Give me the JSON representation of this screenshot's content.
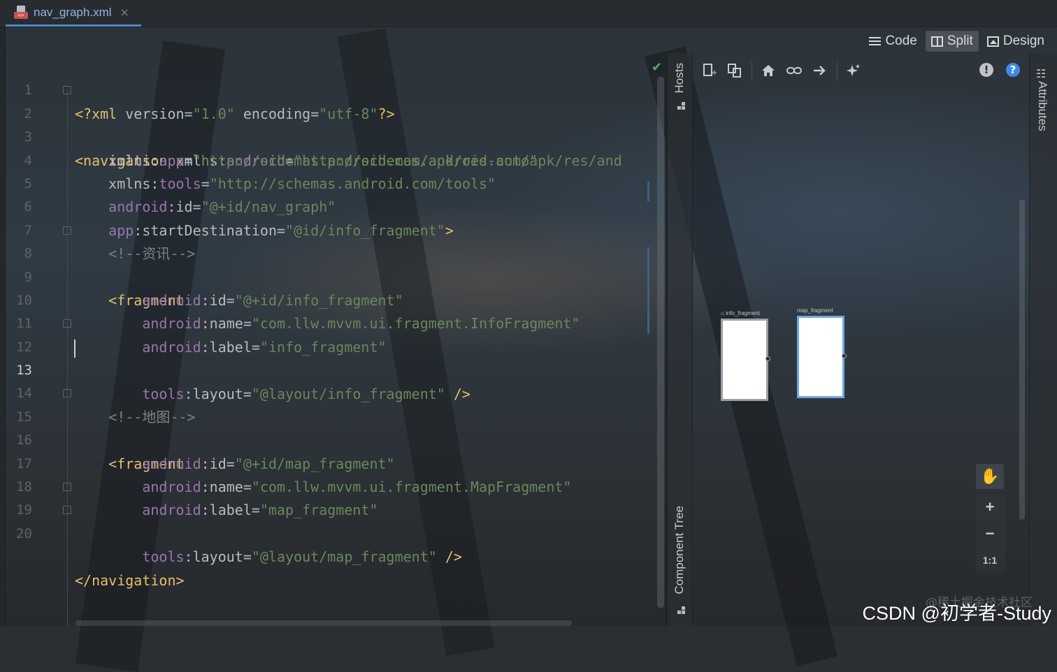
{
  "tab": {
    "filename": "nav_graph.xml",
    "close": "×"
  },
  "view_modes": [
    {
      "label": "Code",
      "icon": "text-lines-icon"
    },
    {
      "label": "Split",
      "icon": "split-view-icon",
      "active": true
    },
    {
      "label": "Design",
      "icon": "image-icon"
    }
  ],
  "editor": {
    "current_line": 13,
    "line_numbers": [
      "1",
      "2",
      "3",
      "4",
      "5",
      "6",
      "7",
      "8",
      "9",
      "10",
      "11",
      "12",
      "13",
      "14",
      "15",
      "16",
      "17",
      "18",
      "19",
      "20"
    ]
  },
  "side_panels": {
    "hosts": "Hosts",
    "component_tree": "Component Tree",
    "attributes": "Attributes"
  },
  "design_toolbar": {
    "icons": [
      "new-destination-icon",
      "nested-graph-icon",
      "home-icon",
      "link-icon",
      "action-arrow-icon",
      "auto-arrange-icon",
      "warning-icon",
      "help-icon"
    ],
    "warning_glyph": "!",
    "help_glyph": "?"
  },
  "canvas": {
    "destinations": [
      {
        "label": "info_fragment",
        "start_destination": true
      },
      {
        "label": "map_fragment",
        "selected": true
      }
    ],
    "zoom": {
      "zoom_in": "+",
      "zoom_out": "−",
      "reset": "1:1"
    }
  },
  "watermarks": {
    "faint": "@稀土掘金技术社区",
    "main": "CSDN @初学者-Study"
  },
  "colors": {
    "tag": "#e8bf6a",
    "namespace": "#9876aa",
    "attribute": "#bababa",
    "value": "#6a8759",
    "comment": "#808080",
    "accent": "#4a88c7",
    "selected_border": "#6fa7e4"
  }
}
